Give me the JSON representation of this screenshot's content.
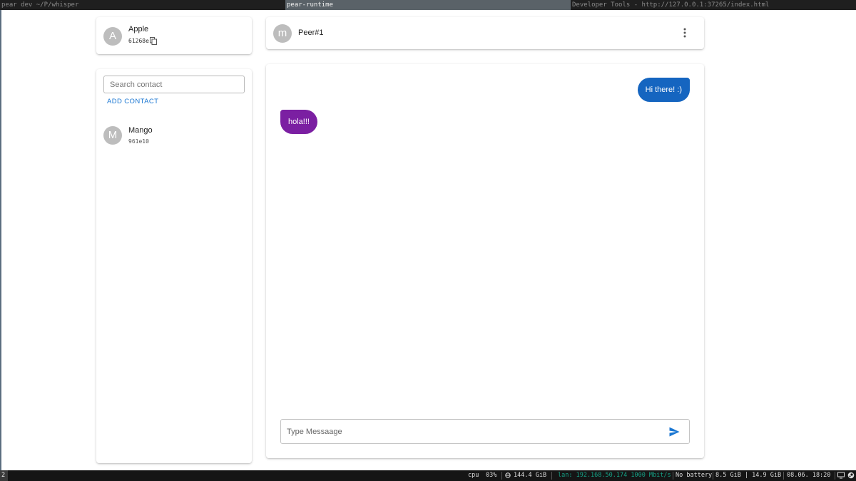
{
  "topbar": {
    "windows": [
      {
        "title": "pear dev ~/P/whisper"
      },
      {
        "title": "pear-runtime"
      },
      {
        "title": "Developer Tools - http://127.0.0.1:37265/index.html"
      }
    ]
  },
  "profile": {
    "avatar_letter": "A",
    "name": "Apple",
    "id": "61268e"
  },
  "contacts": {
    "search_placeholder": "Search contact",
    "add_contact_label": "ADD CONTACT",
    "items": [
      {
        "avatar_letter": "M",
        "name": "Mango",
        "id": "961e10"
      }
    ]
  },
  "peer": {
    "avatar_letter": "m",
    "name": "Peer#1"
  },
  "chat": {
    "messages": [
      {
        "direction": "outgoing",
        "text": "Hi there! :)"
      },
      {
        "direction": "incoming",
        "text": "hola!!!"
      }
    ],
    "input_placeholder": "Type Messaage"
  },
  "statusbar": {
    "workspace": "2",
    "cpu_label": "cpu",
    "cpu_value": "03%",
    "disk": "144.4 GiB",
    "lan": "lan: 192.168.50.174 1000 Mbit/s",
    "battery": "No battery",
    "memory": "8.5 GiB | 14.9 GiB",
    "datetime": "08.06. 18:20"
  },
  "colors": {
    "accent": "#1976d2",
    "outgoing_bubble": "#1565c0",
    "incoming_bubble": "#7b1fa2",
    "avatar": "#bdbdbd"
  }
}
